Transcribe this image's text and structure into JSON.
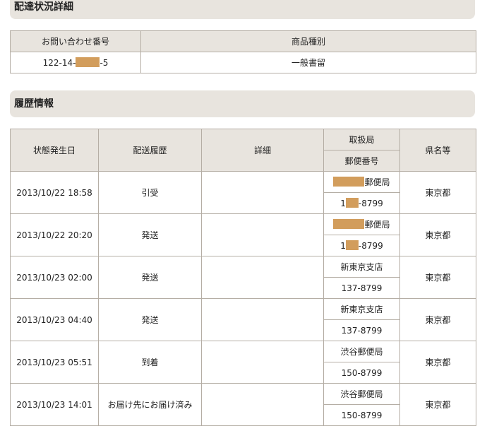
{
  "delivery_detail": {
    "title": "配達状況詳細",
    "headers": [
      "お問い合わせ番号",
      "商品種別"
    ],
    "tracking_prefix": "122-14-",
    "tracking_suffix": "-5",
    "product_type": "一般書留"
  },
  "history": {
    "title": "履歴情報",
    "headers": {
      "date": "状態発生日",
      "status": "配送履歴",
      "detail": "詳細",
      "office": "取扱局",
      "postal": "郵便番号",
      "prefecture": "県名等"
    },
    "rows": [
      {
        "date": "2013/10/22 18:58",
        "status": "引受",
        "detail": "",
        "office_prefix": "",
        "office_suffix": "郵便局",
        "postal_prefix": "1",
        "postal_suffix": "-8799",
        "prefecture": "東京都"
      },
      {
        "date": "2013/10/22 20:20",
        "status": "発送",
        "detail": "",
        "office_prefix": "",
        "office_suffix": "郵便局",
        "postal_prefix": "1",
        "postal_suffix": "-8799",
        "prefecture": "東京都"
      },
      {
        "date": "2013/10/23 02:00",
        "status": "発送",
        "detail": "",
        "office": "新東京支店",
        "postal": "137-8799",
        "prefecture": "東京都"
      },
      {
        "date": "2013/10/23 04:40",
        "status": "発送",
        "detail": "",
        "office": "新東京支店",
        "postal": "137-8799",
        "prefecture": "東京都"
      },
      {
        "date": "2013/10/23 05:51",
        "status": "到着",
        "detail": "",
        "office": "渋谷郵便局",
        "postal": "150-8799",
        "prefecture": "東京都"
      },
      {
        "date": "2013/10/23 14:01",
        "status": "お届け先にお届け済み",
        "detail": "",
        "office": "渋谷郵便局",
        "postal": "150-8799",
        "prefecture": "東京都"
      }
    ]
  },
  "colors": {
    "header_bg": "#e8e4de",
    "border": "#b5aea5",
    "redaction": "#d29d5c"
  }
}
